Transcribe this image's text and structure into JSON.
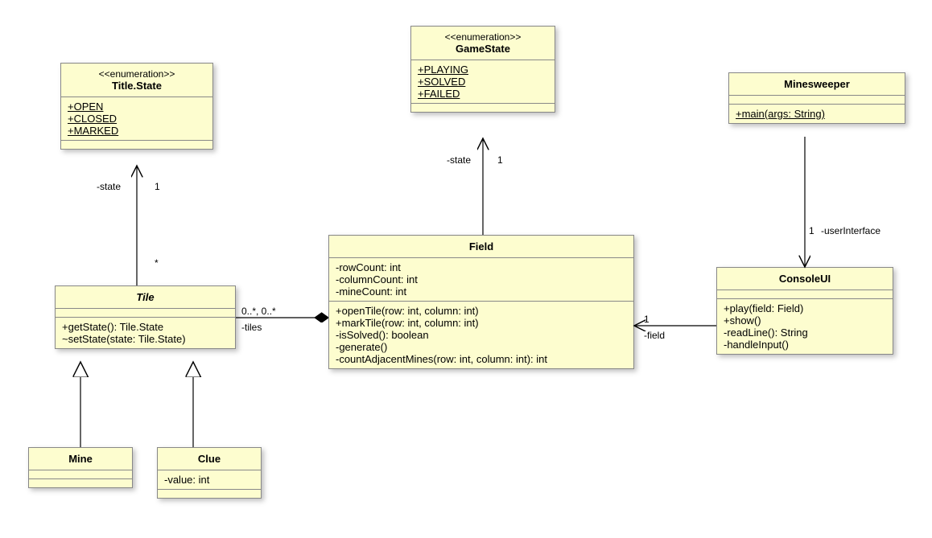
{
  "titleState": {
    "stereotype": "<<enumeration>>",
    "name": "Title.State",
    "values": [
      "+OPEN",
      "+CLOSED",
      "+MARKED"
    ]
  },
  "gameState": {
    "stereotype": "<<enumeration>>",
    "name": "GameState",
    "values": [
      "+PLAYING",
      "+SOLVED",
      "+FAILED"
    ]
  },
  "minesweeper": {
    "name": "Minesweeper",
    "methods": [
      "+main(args: String)"
    ]
  },
  "tile": {
    "name": "Tile",
    "methods": [
      "+getState(): Tile.State",
      "~setState(state: Tile.State)"
    ]
  },
  "field": {
    "name": "Field",
    "attrs": [
      "-rowCount: int",
      "-columnCount: int",
      "-mineCount: int"
    ],
    "methods": [
      "+openTile(row: int, column: int)",
      "+markTile(row: int, column: int)",
      "-isSolved(): boolean",
      "-generate()",
      "-countAdjacentMines(row: int, column: int): int"
    ]
  },
  "consoleUI": {
    "name": "ConsoleUI",
    "methods": [
      "+play(field: Field)",
      "+show()",
      "-readLine(): String",
      "-handleInput()"
    ]
  },
  "mine": {
    "name": "Mine"
  },
  "clue": {
    "name": "Clue",
    "attrs": [
      "-value: int"
    ]
  },
  "labels": {
    "stateTile": "-state",
    "one1": "1",
    "star": "*",
    "stateField": "-state",
    "one2": "1",
    "tiles": "-tiles",
    "mult": "0..*, 0..*",
    "userInterface": "-userInterface",
    "one3": "1",
    "fieldRole": "-field",
    "one4": "1"
  }
}
